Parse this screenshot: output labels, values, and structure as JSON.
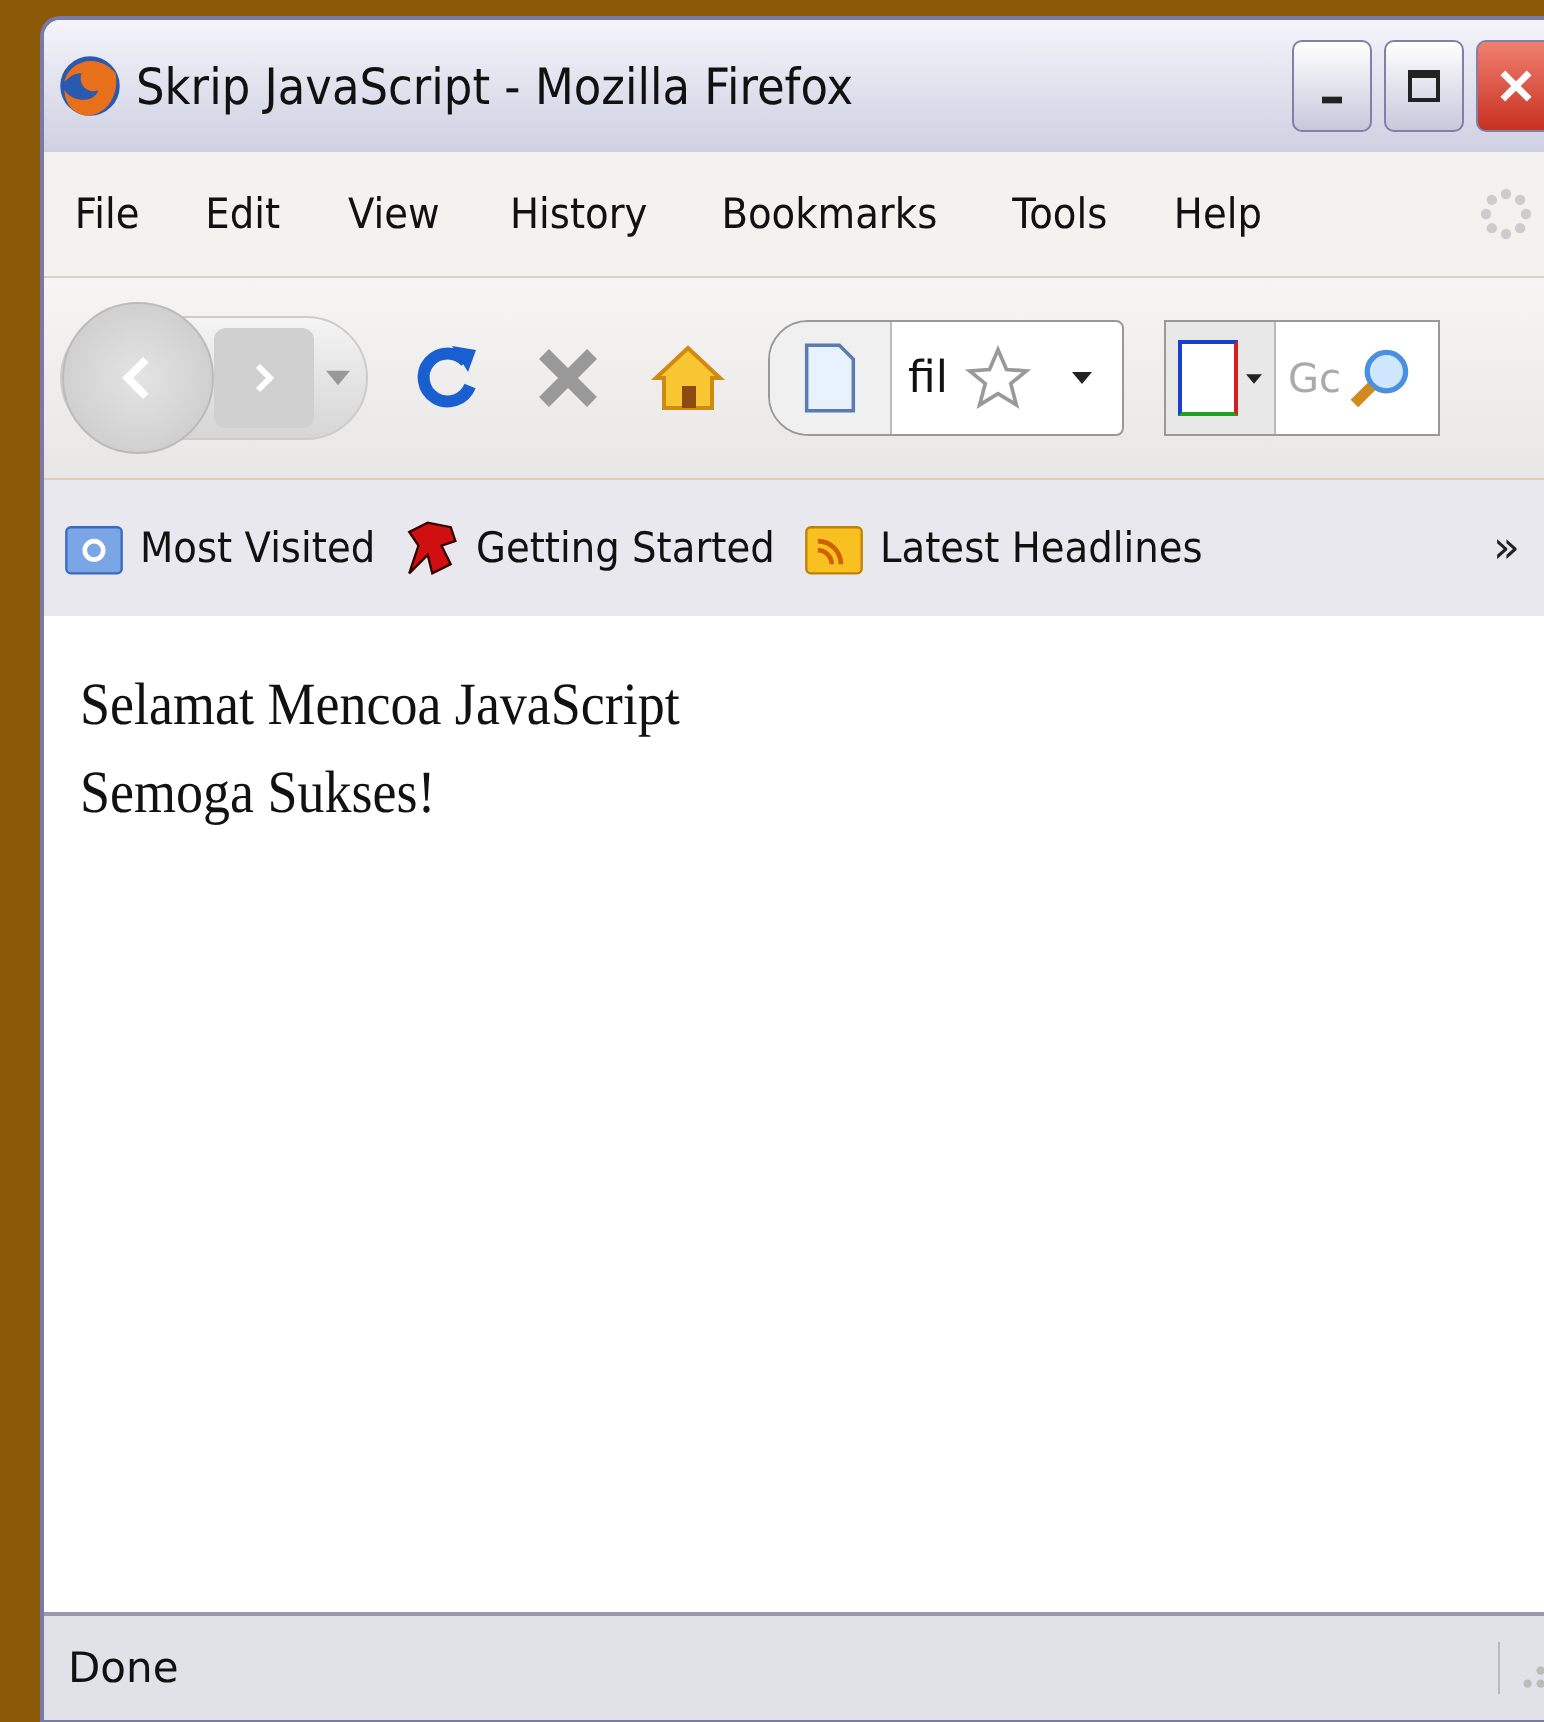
{
  "window": {
    "title": "Skrip JavaScript - Mozilla Firefox"
  },
  "menu": [
    "File",
    "Edit",
    "View",
    "History",
    "Bookmarks",
    "Tools",
    "Help"
  ],
  "address_bar": {
    "value": "fil"
  },
  "search_bar": {
    "placeholder": "Gc"
  },
  "bookmarks": [
    {
      "label": "Most Visited",
      "kind": "folder"
    },
    {
      "label": "Getting Started",
      "kind": "dino"
    },
    {
      "label": "Latest Headlines",
      "kind": "feed"
    }
  ],
  "bookmarks_overflow": "»",
  "content": [
    "Selamat Mencoa JavaScript",
    "Semoga Sukses!"
  ],
  "status_bar": {
    "text": "Done"
  }
}
